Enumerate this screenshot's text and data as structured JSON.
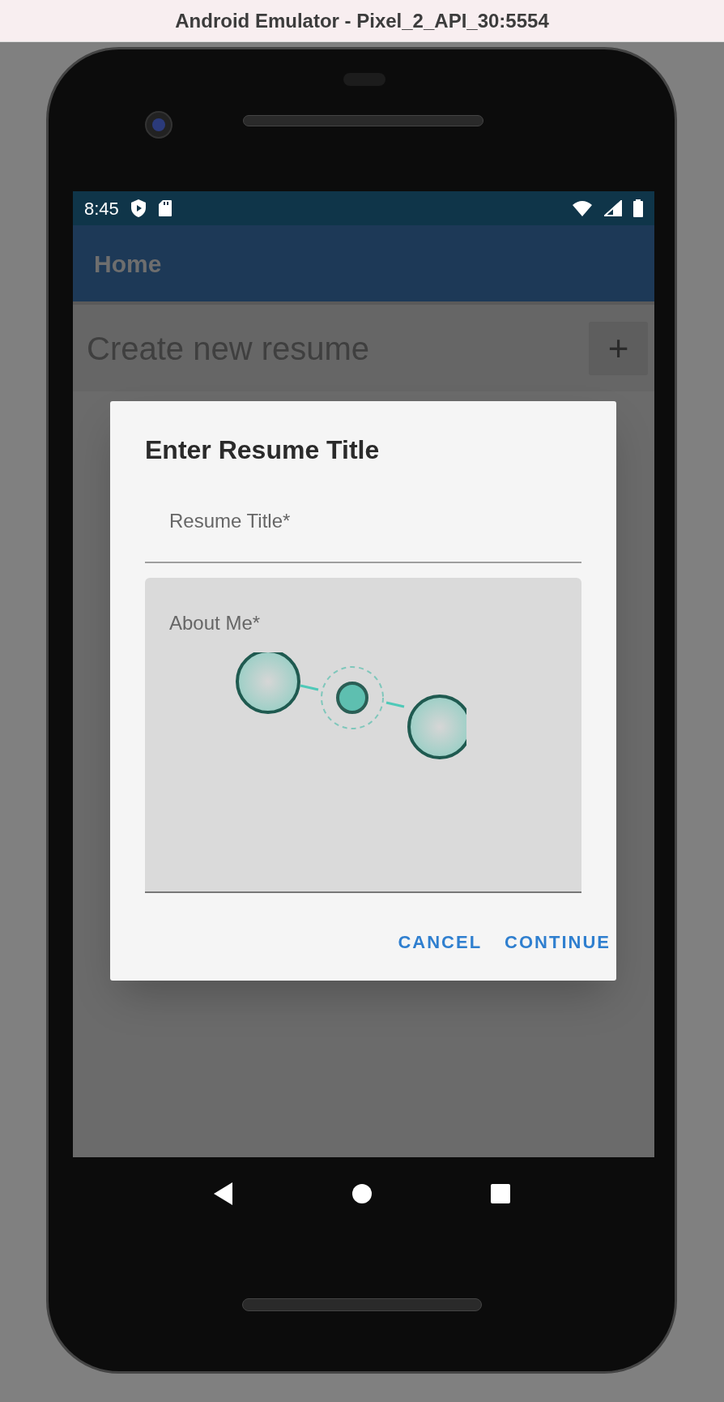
{
  "window": {
    "title": "Android Emulator - Pixel_2_API_30:5554"
  },
  "status_bar": {
    "time": "8:45"
  },
  "app_bar": {
    "title": "Home"
  },
  "content": {
    "label": "Create new resume",
    "add_button": "+"
  },
  "dialog": {
    "title": "Enter Resume Title",
    "fields": [
      {
        "kind": "underlined",
        "placeholder": "Resume Title*"
      },
      {
        "kind": "filled",
        "placeholder": "About Me*"
      }
    ],
    "buttons": [
      "CANCEL",
      "CONTINUE"
    ]
  }
}
